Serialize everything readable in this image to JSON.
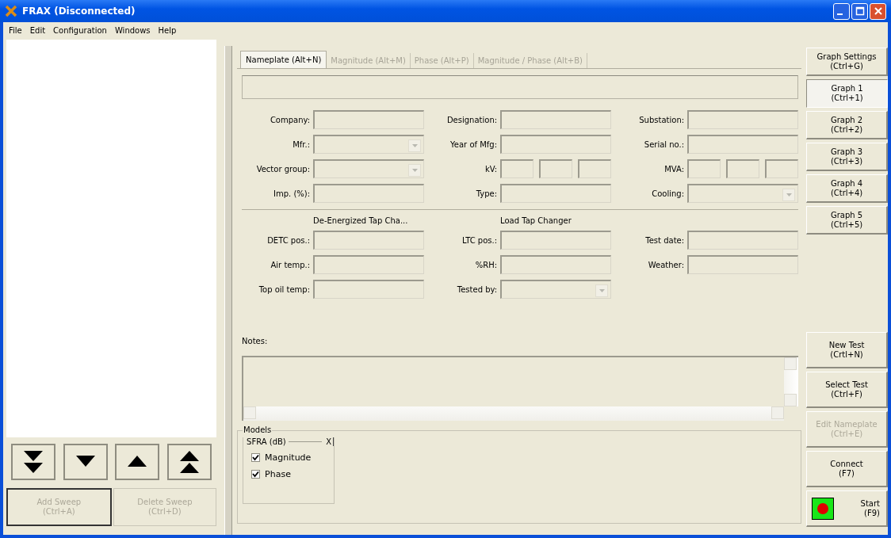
{
  "window": {
    "title": "FRAX (Disconnected)"
  },
  "menu": [
    "File",
    "Edit",
    "Configuration",
    "Windows",
    "Help"
  ],
  "sweep_panel": {
    "nav_buttons": [
      {
        "kind": "bottom"
      },
      {
        "kind": "down"
      },
      {
        "kind": "up"
      },
      {
        "kind": "top"
      }
    ],
    "actions": [
      {
        "label": "Add Sweep",
        "shortcut": "(Ctrl+A)",
        "disabled": true,
        "focused": true
      },
      {
        "label": "Delete Sweep",
        "shortcut": "(Ctrl+D)",
        "disabled": true,
        "focused": false
      }
    ]
  },
  "tabs": [
    {
      "label": "Nameplate (Alt+N)",
      "selected": true
    },
    {
      "label": "Magnitude (Alt+M)",
      "selected": false
    },
    {
      "label": "Phase (Alt+P)",
      "selected": false
    },
    {
      "label": "Magnitude / Phase (Alt+B)",
      "selected": false
    }
  ],
  "nameplate": {
    "rows": [
      [
        {
          "label": "Company:",
          "kind": "text"
        },
        {
          "label": "Designation:",
          "kind": "text"
        },
        {
          "label": "Substation:",
          "kind": "text"
        }
      ],
      [
        {
          "label": "Mfr.:",
          "kind": "dropdown"
        },
        {
          "label": "Year of Mfg:",
          "kind": "text"
        },
        {
          "label": "Serial no.:",
          "kind": "text"
        }
      ],
      [
        {
          "label": "Vector group:",
          "kind": "dropdown"
        },
        {
          "label": "kV:",
          "kind": "triple"
        },
        {
          "label": "MVA:",
          "kind": "triple"
        }
      ],
      [
        {
          "label": "Imp. (%):",
          "kind": "text"
        },
        {
          "label": "Type:",
          "kind": "text"
        },
        {
          "label": "Cooling:",
          "kind": "dropdown"
        }
      ]
    ],
    "headings": [
      "De-Energized Tap Cha...",
      "Load Tap Changer"
    ],
    "test_rows": [
      [
        {
          "label": "DETC pos.:",
          "kind": "text"
        },
        {
          "label": "LTC pos.:",
          "kind": "text"
        },
        {
          "label": "Test date:",
          "kind": "text"
        }
      ],
      [
        {
          "label": "Air temp.:",
          "kind": "text"
        },
        {
          "label": "%RH:",
          "kind": "text"
        },
        {
          "label": "Weather:",
          "kind": "text"
        }
      ],
      [
        {
          "label": "Top oil temp:",
          "kind": "text"
        },
        {
          "label": "Tested by:",
          "kind": "dropdown"
        }
      ]
    ],
    "notes_label": "Notes:"
  },
  "models": {
    "title": "Models",
    "groups": [
      {
        "title": "SFRA (dB)",
        "close": "X",
        "options": [
          {
            "label": "Magnitude",
            "checked": true
          },
          {
            "label": "Phase",
            "checked": true
          }
        ]
      }
    ]
  },
  "graph_buttons": [
    {
      "label": "Graph Settings",
      "shortcut": "(Ctrl+G)",
      "selected": false
    },
    {
      "label": "Graph 1",
      "shortcut": "(Ctrl+1)",
      "selected": true
    },
    {
      "label": "Graph 2",
      "shortcut": "(Ctrl+2)",
      "selected": false
    },
    {
      "label": "Graph 3",
      "shortcut": "(Ctrl+3)",
      "selected": false
    },
    {
      "label": "Graph 4",
      "shortcut": "(Ctrl+4)",
      "selected": false
    },
    {
      "label": "Graph 5",
      "shortcut": "(Ctrl+5)",
      "selected": false
    }
  ],
  "action_buttons": [
    {
      "label": "New Test",
      "shortcut": "(Crtl+N)",
      "disabled": false,
      "kind": "plain"
    },
    {
      "label": "Select Test",
      "shortcut": "(Ctrl+F)",
      "disabled": false,
      "kind": "plain"
    },
    {
      "label": "Edit Nameplate",
      "shortcut": "(Ctrl+E)",
      "disabled": true,
      "kind": "plain"
    },
    {
      "label": "Connect",
      "shortcut": "(F7)",
      "disabled": false,
      "kind": "plain"
    },
    {
      "label": "Start",
      "shortcut": "(F9)",
      "disabled": false,
      "kind": "start"
    }
  ]
}
